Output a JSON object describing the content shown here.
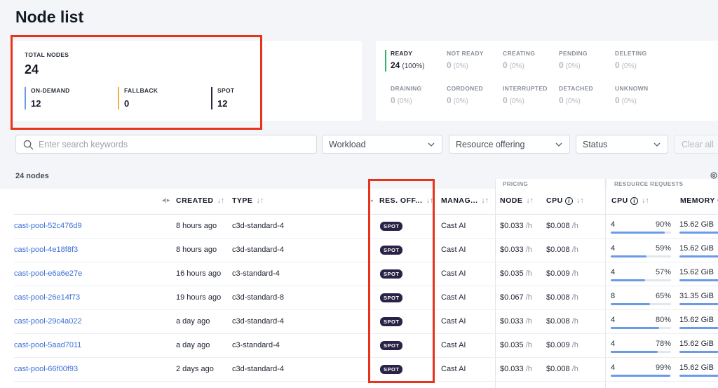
{
  "page_title": "Node list",
  "totals": {
    "label": "TOTAL NODES",
    "value": "24",
    "buckets": [
      {
        "label": "ON-DEMAND",
        "value": "12",
        "color": "#6b9be8"
      },
      {
        "label": "FALLBACK",
        "value": "0",
        "color": "#f0b33c"
      },
      {
        "label": "SPOT",
        "value": "12",
        "color": "#2b2347"
      }
    ]
  },
  "statuses": [
    {
      "label": "READY",
      "value": "24",
      "pct": "(100%)",
      "active": true
    },
    {
      "label": "NOT READY",
      "value": "0",
      "pct": "(0%)"
    },
    {
      "label": "CREATING",
      "value": "0",
      "pct": "(0%)"
    },
    {
      "label": "PENDING",
      "value": "0",
      "pct": "(0%)"
    },
    {
      "label": "DELETING",
      "value": "0",
      "pct": "(0%)"
    },
    {
      "label": "DRAINING",
      "value": "0",
      "pct": "(0%)"
    },
    {
      "label": "CORDONED",
      "value": "0",
      "pct": "(0%)"
    },
    {
      "label": "INTERRUPTED",
      "value": "0",
      "pct": "(0%)"
    },
    {
      "label": "DETACHED",
      "value": "0",
      "pct": "(0%)"
    },
    {
      "label": "UNKNOWN",
      "value": "0",
      "pct": "(0%)"
    }
  ],
  "filters": {
    "search_placeholder": "Enter search keywords",
    "workload": "Workload",
    "resource_offering": "Resource offering",
    "status": "Status",
    "clear_all": "Clear all"
  },
  "node_count": "24 nodes",
  "groups": {
    "pricing": "PRICING",
    "resource_requests": "RESOURCE REQUESTS"
  },
  "columns": {
    "created": "CREATED",
    "type": "TYPE",
    "res_offering": "RES. OFF...",
    "managed_by": "MANAG...",
    "node_price": "NODE",
    "cpu_price": "CPU",
    "cpu_req": "CPU",
    "memory_req": "MEMORY C"
  },
  "sort_glyph": "↓↑",
  "info_glyph": "i",
  "rows": [
    {
      "name": "cast-pool-52c476d9",
      "created": "8 hours ago",
      "type": "c3d-standard-4",
      "offering": "SPOT",
      "managed": "Cast AI",
      "node_price": "$0.033",
      "cpu_price": "$0.008",
      "unit": "/h",
      "cpu_cores": "4",
      "cpu_pct": "90%",
      "cpu_frac": 0.9,
      "memory": "15.62 GiB"
    },
    {
      "name": "cast-pool-4e18f8f3",
      "created": "8 hours ago",
      "type": "c3d-standard-4",
      "offering": "SPOT",
      "managed": "Cast AI",
      "node_price": "$0.033",
      "cpu_price": "$0.008",
      "unit": "/h",
      "cpu_cores": "4",
      "cpu_pct": "59%",
      "cpu_frac": 0.59,
      "memory": "15.62 GiB"
    },
    {
      "name": "cast-pool-e6a6e27e",
      "created": "16 hours ago",
      "type": "c3-standard-4",
      "offering": "SPOT",
      "managed": "Cast AI",
      "node_price": "$0.035",
      "cpu_price": "$0.009",
      "unit": "/h",
      "cpu_cores": "4",
      "cpu_pct": "57%",
      "cpu_frac": 0.57,
      "memory": "15.62 GiB"
    },
    {
      "name": "cast-pool-26e14f73",
      "created": "19 hours ago",
      "type": "c3d-standard-8",
      "offering": "SPOT",
      "managed": "Cast AI",
      "node_price": "$0.067",
      "cpu_price": "$0.008",
      "unit": "/h",
      "cpu_cores": "8",
      "cpu_pct": "65%",
      "cpu_frac": 0.65,
      "memory": "31.35 GiB"
    },
    {
      "name": "cast-pool-29c4a022",
      "created": "a day ago",
      "type": "c3d-standard-4",
      "offering": "SPOT",
      "managed": "Cast AI",
      "node_price": "$0.033",
      "cpu_price": "$0.008",
      "unit": "/h",
      "cpu_cores": "4",
      "cpu_pct": "80%",
      "cpu_frac": 0.8,
      "memory": "15.62 GiB"
    },
    {
      "name": "cast-pool-5aad7011",
      "created": "a day ago",
      "type": "c3-standard-4",
      "offering": "SPOT",
      "managed": "Cast AI",
      "node_price": "$0.035",
      "cpu_price": "$0.009",
      "unit": "/h",
      "cpu_cores": "4",
      "cpu_pct": "78%",
      "cpu_frac": 0.78,
      "memory": "15.62 GiB"
    },
    {
      "name": "cast-pool-66f00f93",
      "created": "2 days ago",
      "type": "c3d-standard-4",
      "offering": "SPOT",
      "managed": "Cast AI",
      "node_price": "$0.033",
      "cpu_price": "$0.008",
      "unit": "/h",
      "cpu_cores": "4",
      "cpu_pct": "99%",
      "cpu_frac": 0.99,
      "memory": "15.62 GiB"
    }
  ]
}
